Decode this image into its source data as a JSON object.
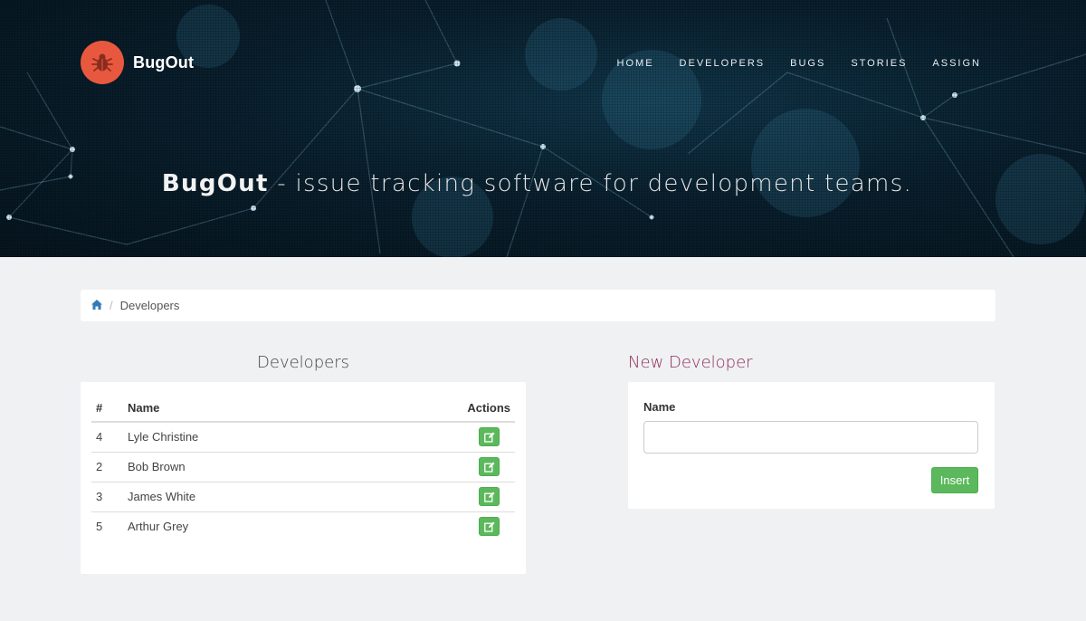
{
  "brand": {
    "name": "BugOut"
  },
  "nav": {
    "items": [
      "HOME",
      "DEVELOPERS",
      "BUGS",
      "STORIES",
      "ASSIGN"
    ]
  },
  "hero": {
    "tagline_brand": "BugOut",
    "tagline_rest": " - issue tracking software for development teams."
  },
  "breadcrumb": {
    "current": "Developers"
  },
  "developers": {
    "title": "Developers",
    "columns": [
      "#",
      "Name",
      "Actions"
    ],
    "rows": [
      {
        "id": "4",
        "name": "Lyle Christine"
      },
      {
        "id": "2",
        "name": "Bob Brown"
      },
      {
        "id": "3",
        "name": "James White"
      },
      {
        "id": "5",
        "name": "Arthur Grey"
      }
    ]
  },
  "new_developer": {
    "title": "New Developer",
    "name_label": "Name",
    "name_value": "",
    "insert_label": "Insert"
  },
  "colors": {
    "accent": "#8c2a5a",
    "success": "#5cb85c",
    "logo": "#e8583f"
  },
  "icons": {
    "logo": "bug-icon",
    "breadcrumb_home": "home-icon",
    "edit": "edit-icon"
  }
}
